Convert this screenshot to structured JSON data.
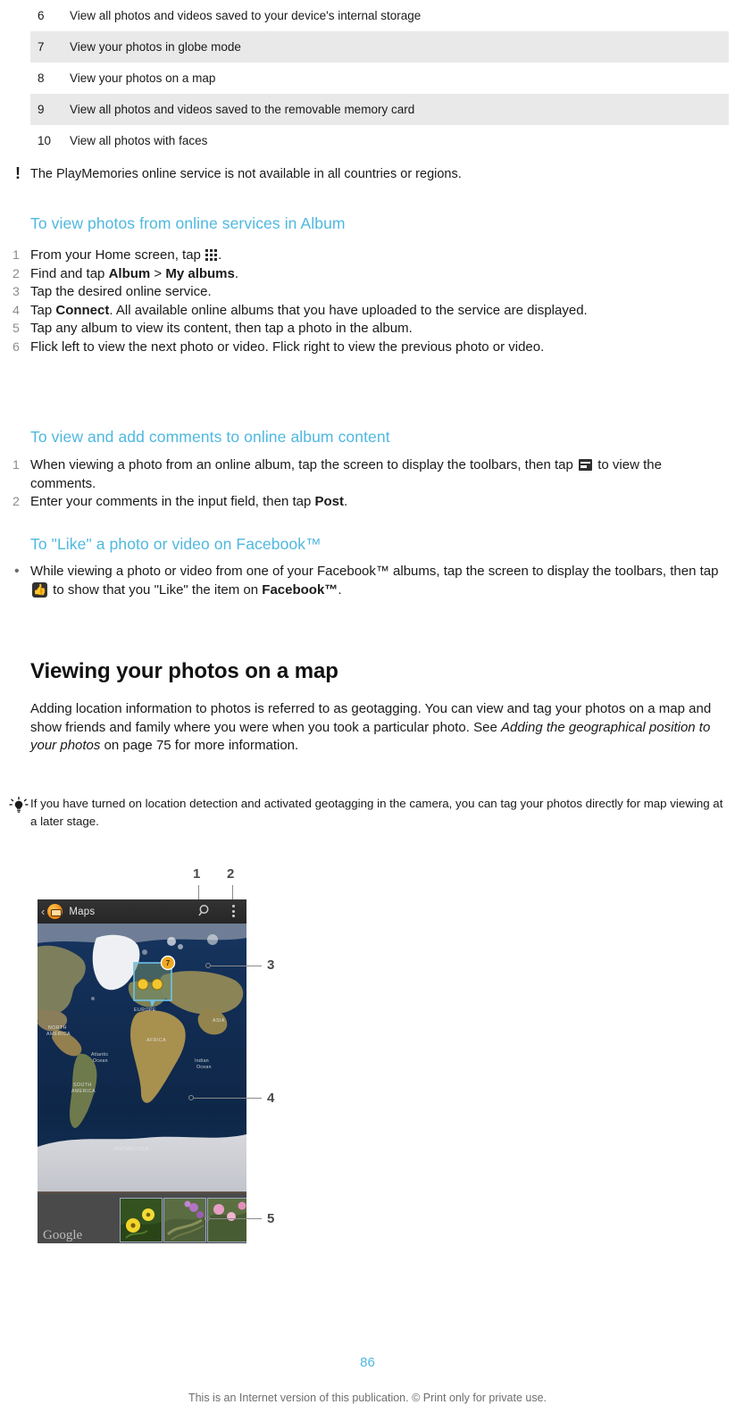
{
  "legend_table": {
    "rows": [
      {
        "num": "6",
        "desc": "View all photos and videos saved to your device's internal storage",
        "shaded": false
      },
      {
        "num": "7",
        "desc": "View your photos in globe mode",
        "shaded": true
      },
      {
        "num": "8",
        "desc": "View your photos on a map",
        "shaded": false
      },
      {
        "num": "9",
        "desc": "View all photos and videos saved to the removable memory card",
        "shaded": true
      },
      {
        "num": "10",
        "desc": "View all photos with faces",
        "shaded": false
      }
    ]
  },
  "note": {
    "icon": "exclamation-icon",
    "text": "The PlayMemories online service is not available in all countries or regions."
  },
  "section_online": {
    "heading": "To view photos from online services in Album",
    "steps": [
      {
        "num": "1",
        "parts": [
          {
            "t": "From your Home screen, tap "
          },
          {
            "icon": "app-drawer-icon"
          },
          {
            "t": "."
          }
        ]
      },
      {
        "num": "2",
        "parts": [
          {
            "t": "Find and tap "
          },
          {
            "b": "Album"
          },
          {
            "t": " > "
          },
          {
            "b": "My albums"
          },
          {
            "t": "."
          }
        ]
      },
      {
        "num": "3",
        "parts": [
          {
            "t": "Tap the desired online service."
          }
        ]
      },
      {
        "num": "4",
        "parts": [
          {
            "t": "Tap "
          },
          {
            "b": "Connect"
          },
          {
            "t": ". All available online albums that you have uploaded to the service are displayed."
          }
        ]
      },
      {
        "num": "5",
        "parts": [
          {
            "t": "Tap any album to view its content, then tap a photo in the album."
          }
        ]
      },
      {
        "num": "6",
        "parts": [
          {
            "t": "Flick left to view the next photo or video. Flick right to view the previous photo or video."
          }
        ]
      }
    ]
  },
  "section_comments": {
    "heading": "To view and add comments to online album content",
    "steps": [
      {
        "num": "1",
        "parts": [
          {
            "t": "When viewing a photo from an online album, tap the screen to display the toolbars, then tap "
          },
          {
            "icon": "comment-icon"
          },
          {
            "t": " to view the comments."
          }
        ]
      },
      {
        "num": "2",
        "parts": [
          {
            "t": "Enter your comments in the input field, then tap "
          },
          {
            "b": "Post"
          },
          {
            "t": "."
          }
        ]
      }
    ]
  },
  "section_like": {
    "heading": "To \"Like\" a photo or video on Facebook™",
    "steps": [
      {
        "bullet": "•",
        "parts": [
          {
            "t": "While viewing a photo or video from one of your Facebook™ albums, tap the screen to display the toolbars, then tap "
          },
          {
            "icon": "thumbs-up-icon"
          },
          {
            "t": " to show that you \"Like\" the item on "
          },
          {
            "b": "Facebook™"
          },
          {
            "t": "."
          }
        ]
      }
    ]
  },
  "section_map": {
    "heading": "Viewing your photos on a map",
    "paragraph": [
      {
        "t": "Adding location information to photos is referred to as geotagging. You can view and tag your photos on a map and show friends and family where you were when you took a particular photo. See "
      },
      {
        "i": "Adding the geographical position to your photos"
      },
      {
        "t": " on page 75 for more information."
      }
    ],
    "tip": {
      "icon": "lightbulb-icon",
      "text": "If you have turned on location detection and activated geotagging in the camera, you can tag your photos directly for map viewing at a later stage."
    }
  },
  "figure": {
    "app_title": "Maps",
    "google_watermark": "Google",
    "map_labels": [
      "NORTH AMERICA",
      "SOUTH AMERICA",
      "EUROPE",
      "AFRICA",
      "ASIA",
      "Atlantic Ocean",
      "Indian Ocean",
      "ANTARCTICA"
    ],
    "cluster_badge": "7",
    "callouts": [
      {
        "label": "1",
        "target": "search-icon"
      },
      {
        "label": "2",
        "target": "overflow-menu-icon"
      },
      {
        "label": "3",
        "target": "photo-cluster-marker"
      },
      {
        "label": "4",
        "target": "map-area"
      },
      {
        "label": "5",
        "target": "photo-thumbnail-strip"
      }
    ]
  },
  "footer": {
    "page_number": "86",
    "notice": "This is an Internet version of this publication. © Print only for private use."
  },
  "colors": {
    "accent": "#4fb8e0",
    "row_shade": "#e9e9e9",
    "body_text": "#1a1a1a",
    "muted": "#8c8c8c"
  }
}
